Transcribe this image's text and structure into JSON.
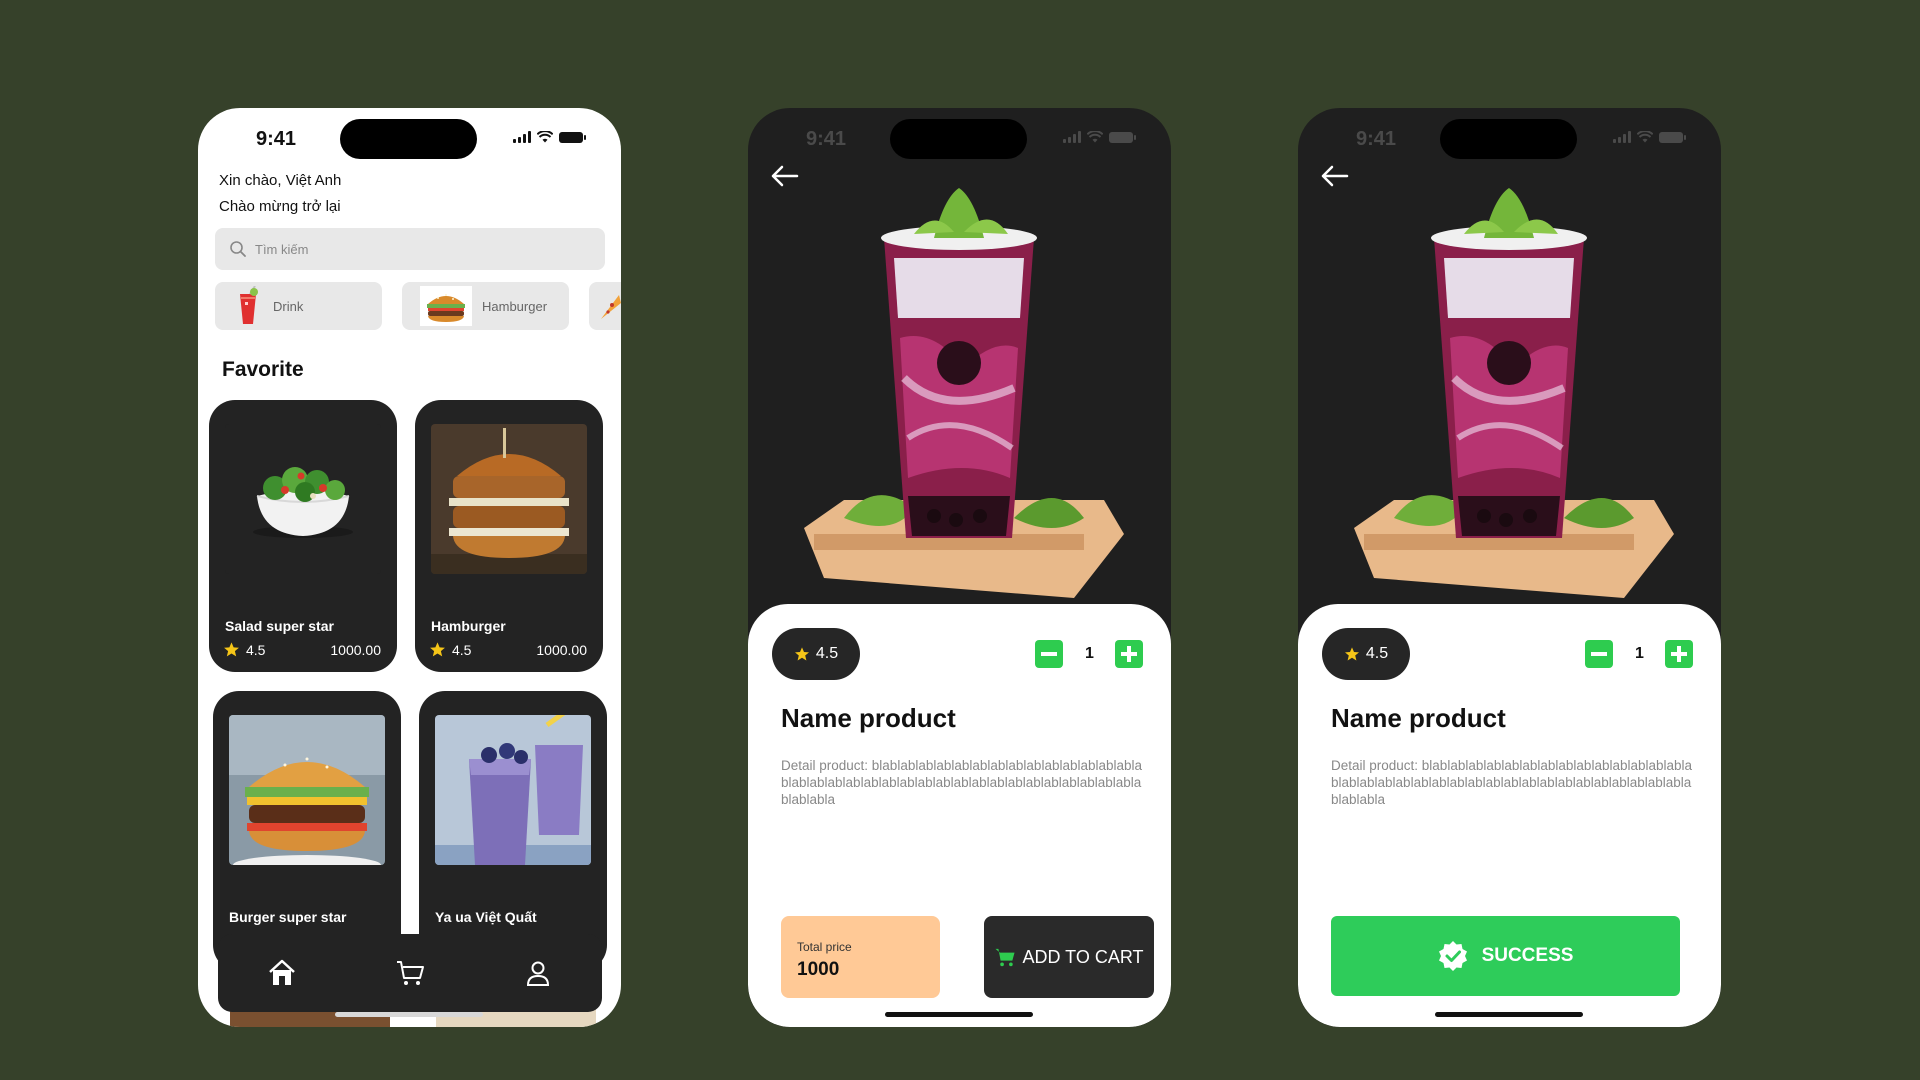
{
  "status": {
    "time": "9:41"
  },
  "home": {
    "greeting": "Xin chào, Việt Anh",
    "welcome": "Chào mừng trở lại",
    "search_placeholder": "Tìm kiếm",
    "categories": [
      {
        "label": "Drink",
        "icon": "drink-icon"
      },
      {
        "label": "Hamburger",
        "icon": "hamburger-icon"
      }
    ],
    "favorite_title": "Favorite",
    "favorites": [
      {
        "name": "Salad super star",
        "rating": "4.5",
        "price": "1000.00"
      },
      {
        "name": "Hamburger",
        "rating": "4.5",
        "price": "1000.00"
      },
      {
        "name": "Burger super star"
      },
      {
        "name": "Ya ua Việt Quất"
      }
    ],
    "nav": [
      "home-icon",
      "cart-icon",
      "user-icon"
    ]
  },
  "detail": {
    "rating": "4.5",
    "quantity": "1",
    "name": "Name product",
    "description": "Detail product: blablablablablablablablablablablablablablablablablablablablablablablablablablablablablablablablablablablablablabla",
    "total_label": "Total price",
    "total_value": "1000",
    "add_to_cart": "ADD TO CART"
  },
  "success": {
    "label": "SUCCESS"
  },
  "colors": {
    "background": "#36412a",
    "accent_green": "#2ecc5a",
    "card_dark": "#232323",
    "total_bg": "#ffc996"
  }
}
